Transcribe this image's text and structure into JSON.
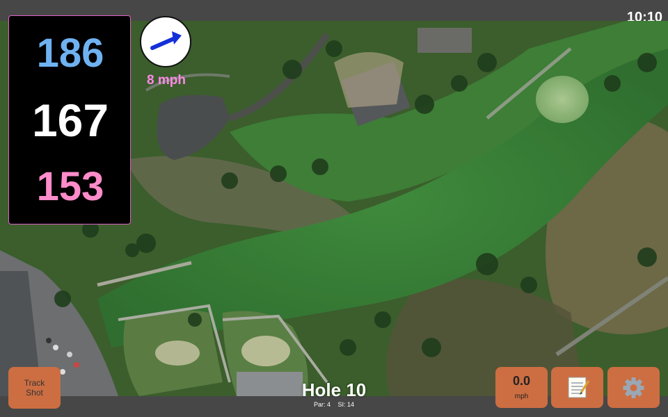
{
  "status": {
    "clock": "10:10"
  },
  "distances": {
    "back": "186",
    "middle": "167",
    "front": "153"
  },
  "wind": {
    "speed_label": "8 mph",
    "direction_icon": "arrow-up-right-icon"
  },
  "buttons": {
    "track_shot_line1": "Track",
    "track_shot_line2": "Shot",
    "speed_value": "0.0",
    "speed_unit": "mph",
    "notes_icon": "notepad-icon",
    "settings_icon": "gear-icon"
  },
  "hole": {
    "title": "Hole 10",
    "par_label": "Par: 4",
    "si_label": "SI: 14"
  },
  "colors": {
    "back_distance": "#6fb2f2",
    "middle_distance": "#ffffff",
    "front_distance": "#ff8cca",
    "wind_speed": "#ff88e6",
    "button": "#cc6e42",
    "bars": "#474747"
  }
}
